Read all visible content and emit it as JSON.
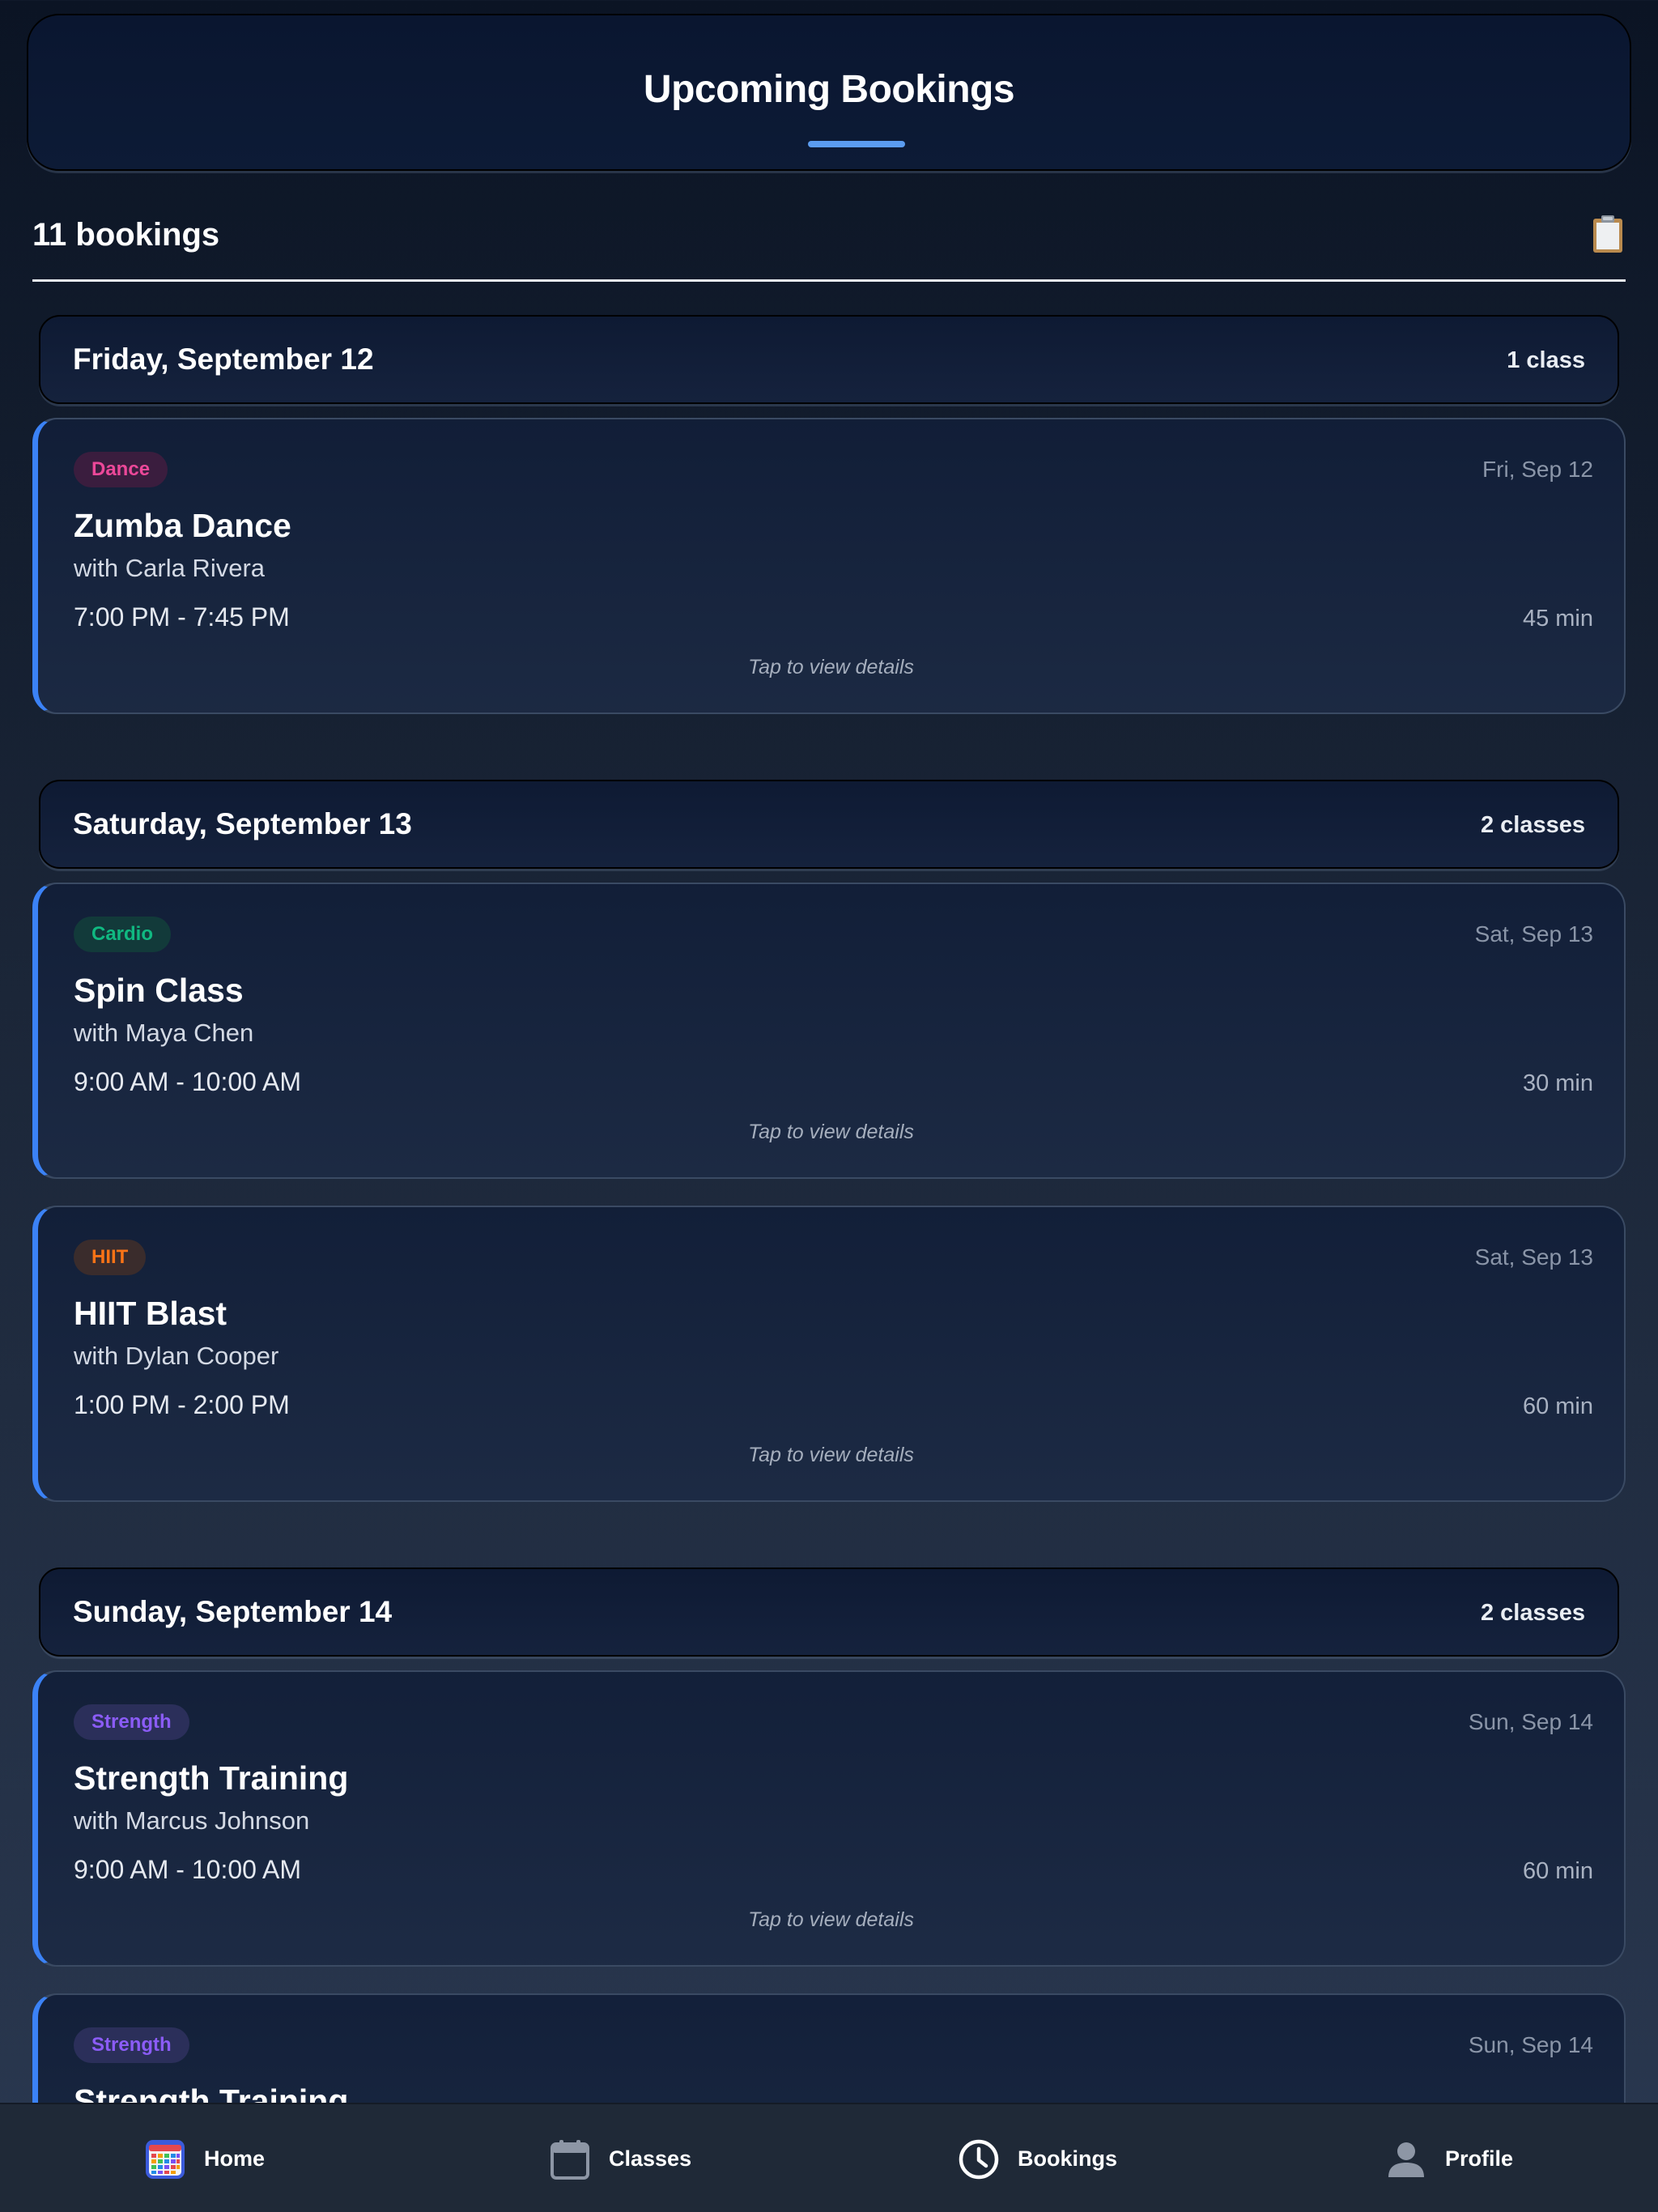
{
  "header": {
    "title": "Upcoming Bookings"
  },
  "summary": {
    "count_label": "11 bookings",
    "icon": "clipboard-icon"
  },
  "days": [
    {
      "title": "Friday, September 12",
      "count": "1 class",
      "cards": [
        {
          "tag": "Dance",
          "date": "Fri, Sep 12",
          "title": "Zumba Dance",
          "instructor": "with Carla Rivera",
          "time": "7:00 PM - 7:45 PM",
          "duration": "45 min",
          "hint": "Tap to view details"
        }
      ]
    },
    {
      "title": "Saturday, September 13",
      "count": "2 classes",
      "cards": [
        {
          "tag": "Cardio",
          "date": "Sat, Sep 13",
          "title": "Spin Class",
          "instructor": "with Maya Chen",
          "time": "9:00 AM - 10:00 AM",
          "duration": "30 min",
          "hint": "Tap to view details"
        },
        {
          "tag": "HIIT",
          "date": "Sat, Sep 13",
          "title": "HIIT Blast",
          "instructor": "with Dylan Cooper",
          "time": "1:00 PM - 2:00 PM",
          "duration": "60 min",
          "hint": "Tap to view details"
        }
      ]
    },
    {
      "title": "Sunday, September 14",
      "count": "2 classes",
      "cards": [
        {
          "tag": "Strength",
          "date": "Sun, Sep 14",
          "title": "Strength Training",
          "instructor": "with Marcus Johnson",
          "time": "9:00 AM - 10:00 AM",
          "duration": "60 min",
          "hint": "Tap to view details"
        },
        {
          "tag": "Strength",
          "date": "Sun, Sep 14",
          "title": "Strength Training"
        }
      ]
    }
  ],
  "tag_colors": {
    "Dance": "#ec4899",
    "Cardio": "#10b981",
    "HIIT": "#f97316",
    "Strength": "#8b5cf6"
  },
  "accent_color": "#3b82f6",
  "nav": [
    {
      "label": "Home",
      "icon": "calendar-grid-icon"
    },
    {
      "label": "Classes",
      "icon": "calendar-icon"
    },
    {
      "label": "Bookings",
      "icon": "clock-icon"
    },
    {
      "label": "Profile",
      "icon": "person-icon"
    }
  ]
}
